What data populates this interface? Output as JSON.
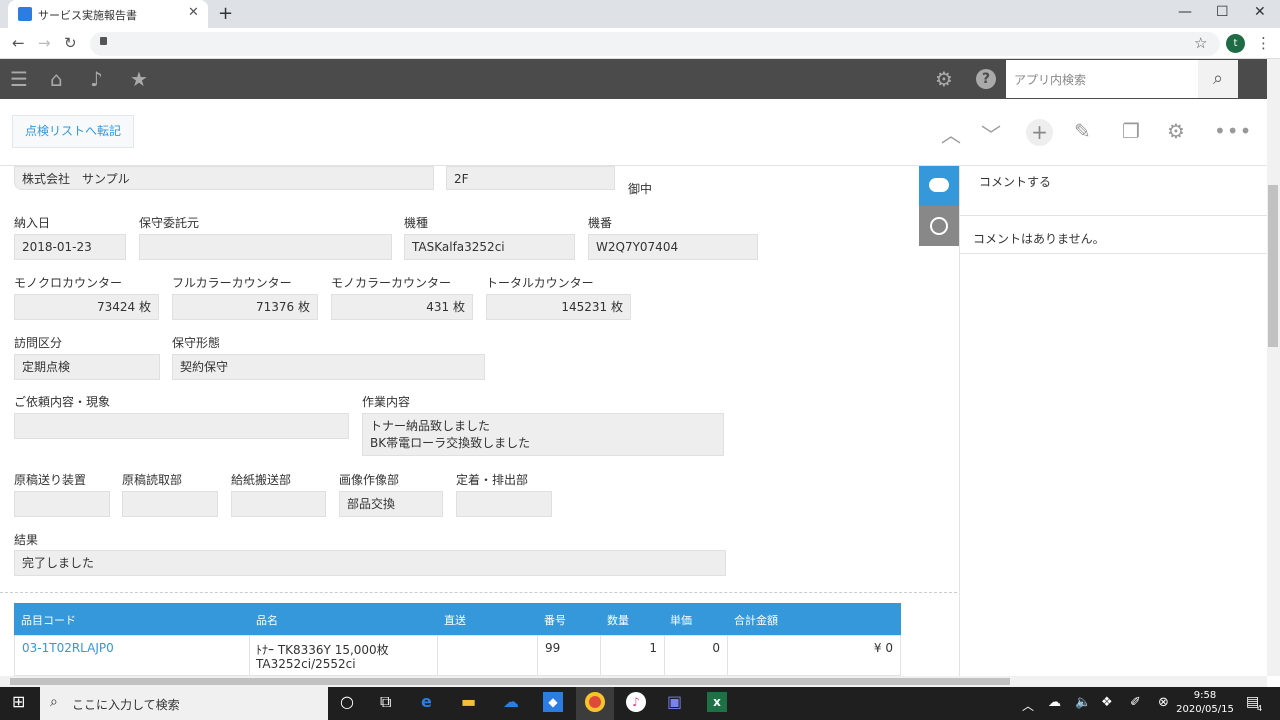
{
  "browser": {
    "tab_title": "サービス実施報告書",
    "tab_close": "✕",
    "new_tab": "+",
    "minimize": "—",
    "maximize": "☐",
    "close": "✕",
    "avatar_letter": "t"
  },
  "header": {
    "search_placeholder": "アプリ内検索"
  },
  "toolbar": {
    "transfer_label": "点検リストへ転記"
  },
  "form": {
    "company": "株式会社　サンプル",
    "floor": "2F",
    "honorific": "御中",
    "delivery_date_label": "納入日",
    "delivery_date": "2018-01-23",
    "maintenance_consignor_label": "保守委託元",
    "maintenance_consignor": "",
    "model_label": "機種",
    "model": "TASKalfa3252ci",
    "serial_label": "機番",
    "serial": "W2Q7Y07404",
    "mono_counter_label": "モノクロカウンター",
    "mono_counter": "73424 枚",
    "full_color_counter_label": "フルカラーカウンター",
    "full_color_counter": "71376 枚",
    "mono_color_counter_label": "モノカラーカウンター",
    "mono_color_counter": "431 枚",
    "total_counter_label": "トータルカウンター",
    "total_counter": "145231 枚",
    "visit_type_label": "訪問区分",
    "visit_type": "定期点検",
    "maintenance_type_label": "保守形態",
    "maintenance_type": "契約保守",
    "request_label": "ご依頼内容・現象",
    "request": "",
    "work_label": "作業内容",
    "work_line1": "トナー納品致しました",
    "work_line2": "BK帯電ローラ交換致しました",
    "doc_feeder_label": "原稿送り装置",
    "doc_feeder": "",
    "doc_reader_label": "原稿読取部",
    "doc_reader": "",
    "paper_feed_label": "給紙搬送部",
    "paper_feed": "",
    "imaging_label": "画像作像部",
    "imaging": "部品交換",
    "fixing_label": "定着・排出部",
    "fixing": "",
    "result_label": "結果",
    "result": "完了しました"
  },
  "table": {
    "headers": [
      "品目コード",
      "品名",
      "直送",
      "番号",
      "数量",
      "単価",
      "合計金額"
    ],
    "rows": [
      {
        "code": "03-1T02RLAJP0",
        "name_line1": "ﾄﾅｰ TK8336Y 15,000枚",
        "name_line2": "TA3252ci/2552ci",
        "direct": "",
        "number": "99",
        "qty": "1",
        "unit_price": "0",
        "total": "¥ 0"
      }
    ]
  },
  "comments": {
    "post_label": "コメントする",
    "empty_message": "コメントはありません。"
  },
  "taskbar": {
    "search_placeholder": "ここに入力して検索",
    "time": "9:58",
    "date": "2020/05/15",
    "notification_count": "4"
  },
  "colors": {
    "accent": "#3498db",
    "header_bg": "#4b4b4b",
    "field_bg": "#eeeeee"
  }
}
